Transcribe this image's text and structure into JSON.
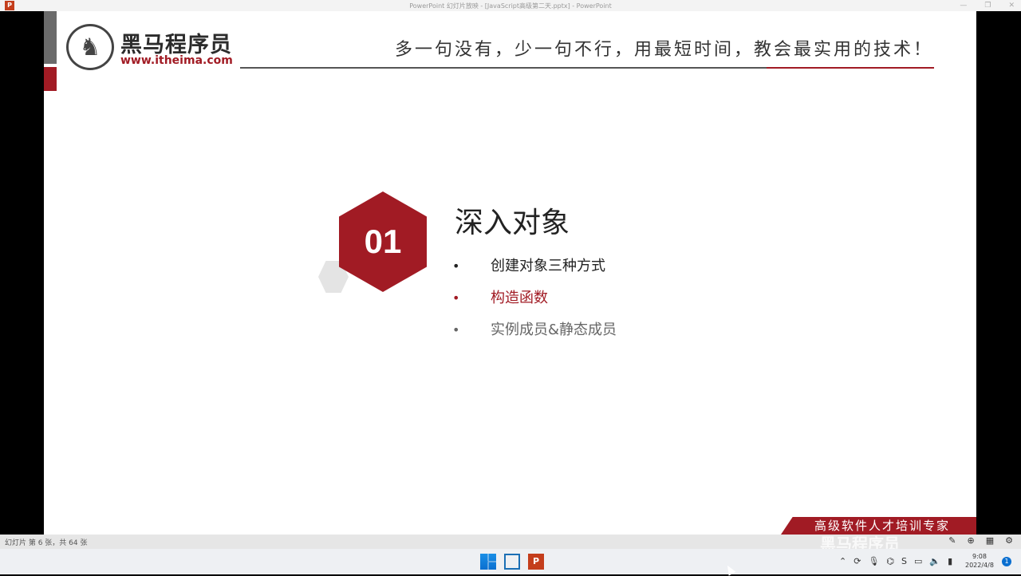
{
  "window": {
    "title": "PowerPoint 幻灯片放映 - [JavaScript高级第二天.pptx] - PowerPoint",
    "app_icon": "P",
    "controls": [
      "—",
      "❐",
      "✕"
    ]
  },
  "slide": {
    "logo": {
      "name": "黑马程序员",
      "url": "www.itheima.com"
    },
    "slogan": "多一句没有，少一句不行，用最短时间，教会最实用的技术！",
    "section_number": "01",
    "section_title": "深入对象",
    "bullets": [
      {
        "bullet": "•",
        "text": "创建对象三种方式",
        "color": "#222222"
      },
      {
        "bullet": "•",
        "text": "构造函数",
        "color": "#a11b24"
      },
      {
        "bullet": "•",
        "text": "实例成员&静态成员",
        "color": "#666666"
      }
    ],
    "footer_slogan": "高级软件人才培训专家"
  },
  "status_bar": {
    "slide_count": "幻灯片 第 6 张，共 64 张"
  },
  "watermark": "黑马程序员",
  "taskbar": {
    "time": "9:08",
    "date": "2022/4/8"
  },
  "colors": {
    "accent_red": "#a11b24",
    "header_grey": "#6b6b6b"
  }
}
